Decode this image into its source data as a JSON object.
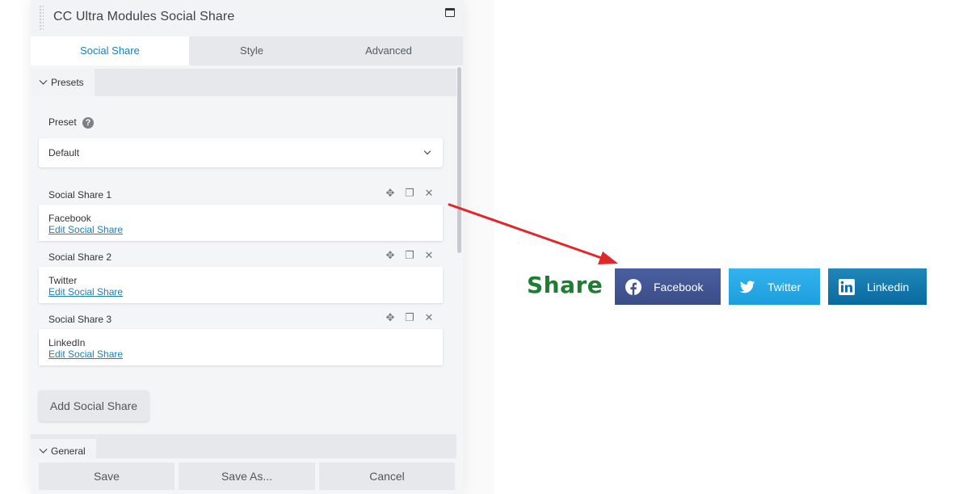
{
  "panel": {
    "title": "CC Ultra Modules Social Share",
    "tabs": [
      {
        "label": "Social Share",
        "active": true
      },
      {
        "label": "Style",
        "active": false
      },
      {
        "label": "Advanced",
        "active": false
      }
    ]
  },
  "presets": {
    "section_label": "Presets",
    "preset_label": "Preset",
    "help_glyph": "?",
    "selected": "Default"
  },
  "items": [
    {
      "title": "Social Share 1",
      "name": "Facebook",
      "link": "Edit Social Share"
    },
    {
      "title": "Social Share 2",
      "name": "Twitter",
      "link": "Edit Social Share"
    },
    {
      "title": "Social Share 3",
      "name": "LinkedIn",
      "link": "Edit Social Share"
    }
  ],
  "add_button": "Add Social Share",
  "general_label": "General",
  "footer": {
    "save": "Save",
    "save_as": "Save As...",
    "cancel": "Cancel"
  },
  "preview": {
    "share_label": "Share",
    "share_color": "#1b7e30",
    "buttons": [
      {
        "label": "Facebook",
        "icon": "facebook-icon",
        "color": "#3b5998"
      },
      {
        "label": "Twitter",
        "icon": "twitter-icon",
        "color": "#1da1f2"
      },
      {
        "label": "Linkedin",
        "icon": "linkedin-icon",
        "color": "#0e76a8"
      }
    ]
  },
  "arrow_color": "#e0282b"
}
